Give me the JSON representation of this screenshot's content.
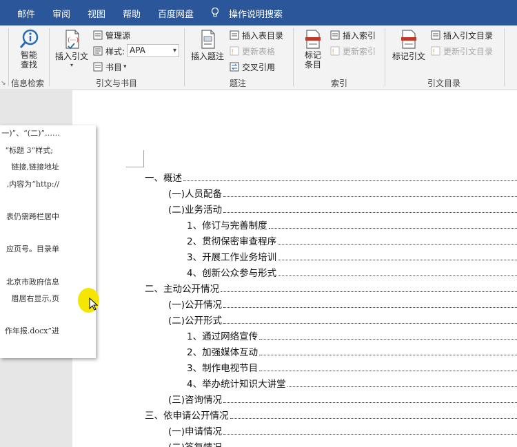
{
  "tabs": [
    {
      "label": "邮件"
    },
    {
      "label": "审阅"
    },
    {
      "label": "视图"
    },
    {
      "label": "帮助"
    },
    {
      "label": "百度网盘"
    },
    {
      "label": "操作说明搜索"
    }
  ],
  "ribbon": {
    "research": {
      "smart_lookup": "智能\n查找",
      "group": "信息检索"
    },
    "citations": {
      "insert_citation": "插入引文",
      "manage_sources": "管理源",
      "style_label": "样式:",
      "style_value": "APA",
      "bibliography": "书目",
      "group": "引文与书目"
    },
    "captions": {
      "insert_caption": "插入题注",
      "insert_table_of_figures": "插入表目录",
      "update_table": "更新表格",
      "cross_reference": "交叉引用",
      "group": "题注"
    },
    "index": {
      "mark_entry": "标记\n条目",
      "insert_index": "插入索引",
      "update_index": "更新索引",
      "group": "索引"
    },
    "toa": {
      "mark_citation": "标记引文",
      "insert_toa": "插入引文目录",
      "update_toa": "更新引文目录",
      "group": "引文目录"
    }
  },
  "overlay_doc": {
    "lines": [
      "一)”、“(二)”……",
      "“标题 3”样式;",
      "链接,链接地址",
      ",内容为“http://",
      "表仍需跨栏居中",
      "应页号。目录单",
      "北京市政府信息",
      "眉居右显示,页",
      "作年报.docx”进"
    ]
  },
  "toc": [
    {
      "text": "一、概述"
    },
    {
      "text": "(一)人员配备"
    },
    {
      "text": "(二)业务活动"
    },
    {
      "text": "1、修订与完善制度"
    },
    {
      "text": "2、贯彻保密审查程序"
    },
    {
      "text": "3、开展工作业务培训"
    },
    {
      "text": "4、创新公众参与形式"
    },
    {
      "text": "二、主动公开情况"
    },
    {
      "text": "(一)公开情况"
    },
    {
      "text": "(二)公开形式"
    },
    {
      "text": "1、通过网络宣传"
    },
    {
      "text": "2、加强媒体互动"
    },
    {
      "text": "3、制作电视节目"
    },
    {
      "text": "4、举办统计知识大讲堂"
    },
    {
      "text": "(三)咨询情况"
    },
    {
      "text": "三、依申请公开情况"
    },
    {
      "text": "(一)申请情况"
    },
    {
      "text": "(二)答复情况"
    }
  ]
}
